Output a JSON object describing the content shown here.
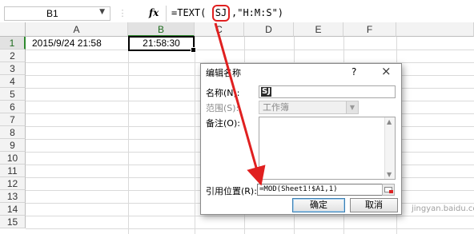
{
  "name_box": {
    "value": "B1"
  },
  "formula_bar": {
    "fx_label": "fx",
    "formula_prefix": "=TEXT(",
    "formula_highlight": "SJ",
    "formula_suffix": ",\"H:M:S\")"
  },
  "grid": {
    "columns": [
      "A",
      "B",
      "C",
      "D",
      "E",
      "F"
    ],
    "rows": [
      "1",
      "2",
      "3",
      "4",
      "5",
      "6",
      "7",
      "8",
      "9",
      "10",
      "11",
      "12",
      "13",
      "14",
      "15"
    ],
    "active_column": "B",
    "active_row": "1",
    "cells": {
      "A1": "2015/9/24 21:58",
      "B1": "21:58:30"
    }
  },
  "dialog": {
    "title": "编辑名称",
    "help": "?",
    "close": "×",
    "name_label": "名称(N):",
    "name_value": "SJ",
    "scope_label": "范围(S):",
    "scope_value": "工作簿",
    "comment_label": "备注(O):",
    "comment_value": "",
    "refers_label": "引用位置(R):",
    "refers_value": "=MOD(Sheet1!$A1,1)",
    "ok_label": "确定",
    "cancel_label": "取消"
  },
  "watermark": "jingyan.baidu.com",
  "colors": {
    "annotation": "#e02020",
    "selection": "#000000",
    "active_header": "#2f8a2f"
  }
}
